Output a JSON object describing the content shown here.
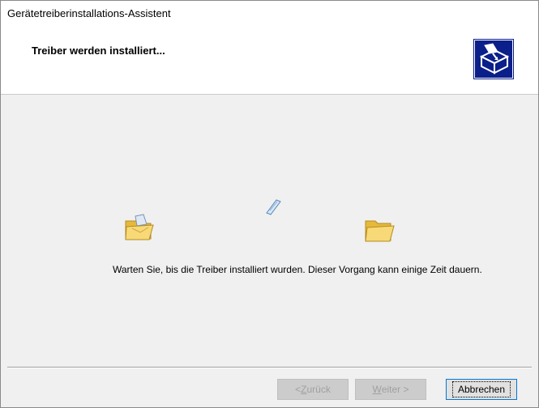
{
  "window": {
    "title": "Gerätetreiberinstallations-Assistent"
  },
  "header": {
    "title": "Treiber werden installiert..."
  },
  "content": {
    "status_text": "Warten Sie, bis die Treiber installiert wurden. Dieser Vorgang kann einige Zeit dauern."
  },
  "buttons": {
    "back_prefix": "< ",
    "back_mnemonic": "Z",
    "back_rest": "urück",
    "next_mnemonic": "W",
    "next_rest": "eiter >",
    "cancel": "Abbrechen"
  },
  "icons": {
    "header": "setup-wizard-icon",
    "source": "source-folder-icon",
    "file": "flying-file-icon",
    "target": "target-folder-icon"
  },
  "colors": {
    "accent": "#0078d7",
    "folder": "#f5d36b",
    "header_icon_bg": "#0a1f8a"
  }
}
